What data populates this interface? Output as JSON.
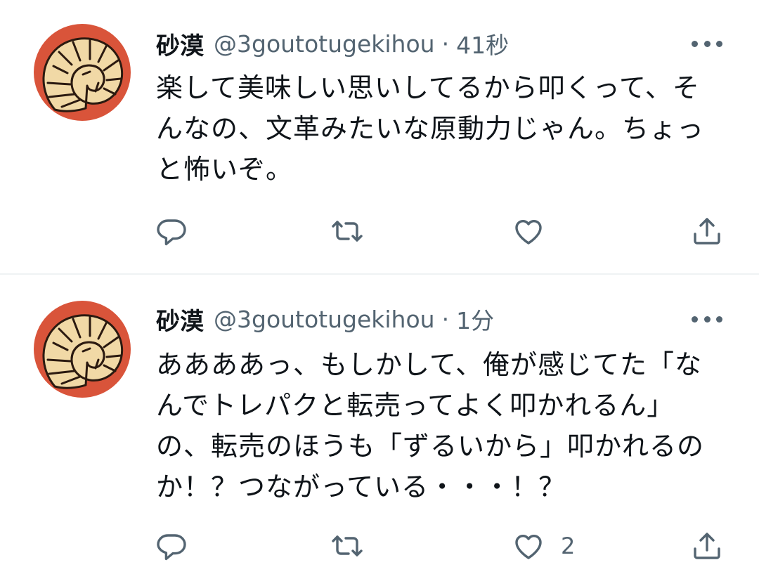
{
  "tweets": [
    {
      "display_name": "砂漠",
      "handle": "@3goutotugekihou",
      "separator": "·",
      "time": "41秒",
      "text": "楽して美味しい思いしてるから叩くって、そんなの、文革みたいな原動力じゃん。ちょっと怖いぞ。",
      "like_count": ""
    },
    {
      "display_name": "砂漠",
      "handle": "@3goutotugekihou",
      "separator": "·",
      "time": "1分",
      "text": "ああああっ、もしかして、俺が感じてた「なんでトレパクと転売ってよく叩かれるん」の、転売のほうも「ずるいから」叩かれるのか！？つながっている・・・！？",
      "like_count": "2"
    }
  ],
  "icons": {
    "more": "more-icon",
    "reply": "reply-icon",
    "retweet": "retweet-icon",
    "like": "heart-icon",
    "share": "share-icon"
  },
  "colors": {
    "text_primary": "#0f1419",
    "text_secondary": "#536471",
    "avatar_background": "#d9543a",
    "avatar_shell": "#f1d9a6",
    "divider": "#eff3f4"
  }
}
